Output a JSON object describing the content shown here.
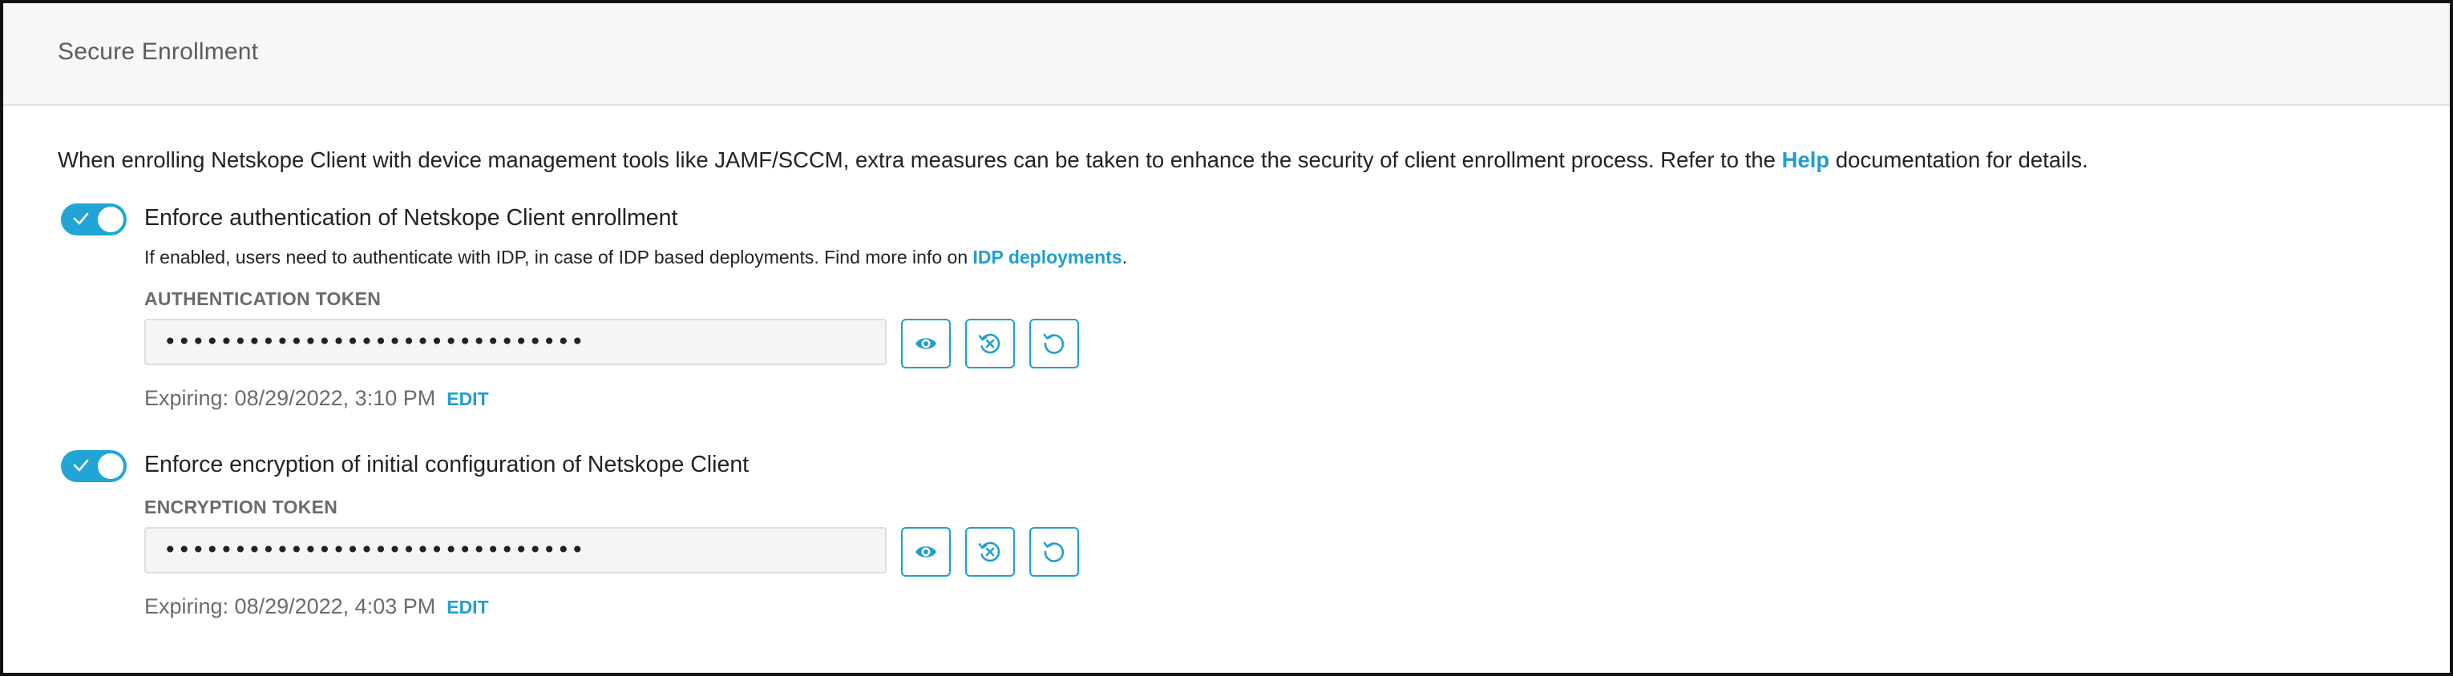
{
  "header": {
    "title": "Secure Enrollment"
  },
  "intro": {
    "text_before": "When enrolling Netskope Client with device management tools like JAMF/SCCM, extra measures can be taken to enhance the security of client enrollment process. Refer to the ",
    "link_label": "Help",
    "text_after": " documentation for details."
  },
  "auth": {
    "toggle_on": true,
    "label": "Enforce authentication of Netskope Client enrollment",
    "note_before": "If enabled, users need to authenticate with IDP, in case of IDP based deployments. Find more info on ",
    "note_link": "IDP deployments",
    "note_after": ".",
    "token_label": "AUTHENTICATION TOKEN",
    "token_value": "••••••••••••••••••••••••••••••",
    "expiry": "Expiring: 08/29/2022, 3:10 PM",
    "edit_label": "EDIT"
  },
  "encryption": {
    "toggle_on": true,
    "label": "Enforce encryption of initial configuration of Netskope Client",
    "token_label": "ENCRYPTION TOKEN",
    "token_value": "••••••••••••••••••••••••••••••",
    "expiry": "Expiring: 08/29/2022, 4:03 PM",
    "edit_label": "EDIT"
  },
  "icons": {
    "show": "eye-icon",
    "revoke": "revoke-icon",
    "regenerate": "refresh-icon"
  },
  "colors": {
    "accent": "#1f9fd0",
    "toggle": "#21a5d6",
    "muted_text": "#6b6b6b"
  }
}
